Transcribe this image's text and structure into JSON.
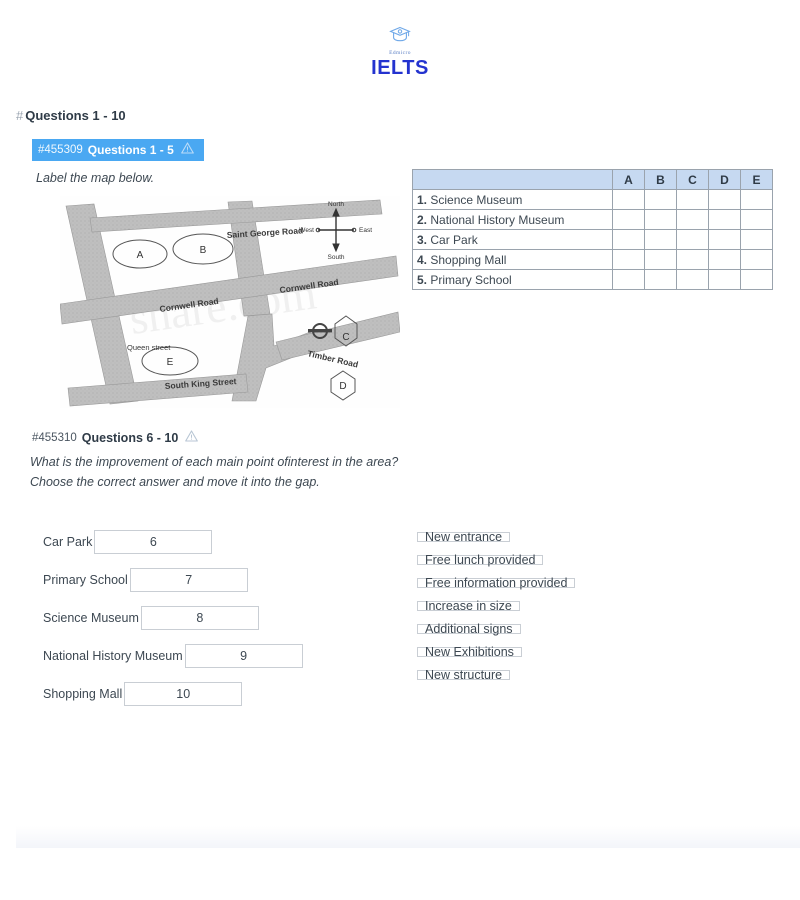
{
  "brand": {
    "icon": "graduation-cap-icon",
    "sub": "Edmicro",
    "name": "IELTS",
    "colors": {
      "wordmark": "#2433cf",
      "sub": "#5b7fc4",
      "accent": "#4aa8f2"
    }
  },
  "page_heading": {
    "hash": "#",
    "text": "Questions 1 - 10"
  },
  "sections": [
    {
      "id": "#455309",
      "title": "Questions 1 - 5",
      "warning_icon": "warning-triangle-icon",
      "instruction": "Label the map below."
    },
    {
      "id": "#455310",
      "title": "Questions 6 - 10",
      "warning_icon": "warning-triangle-icon",
      "instruction_line1": "What is the improvement of each main point ofinterest in the area?",
      "instruction_line2": "Choose the correct answer and move it into the gap."
    }
  ],
  "map": {
    "alt": "black and white scanned street map",
    "roads": [
      "Saint George Road",
      "Cornwell Road",
      "Cornwell Road",
      "Queen street",
      "South King Street",
      "Timber Road"
    ],
    "oval_labels": [
      "A",
      "B",
      "E"
    ],
    "hexagon_labels": [
      "C",
      "D"
    ],
    "compass": {
      "north": "North",
      "south": "South",
      "west": "West",
      "east": "East"
    },
    "watermark": "share.com",
    "station_icon": "underground-roundel-icon"
  },
  "answer_table": {
    "blank_header": "",
    "columns": [
      "A",
      "B",
      "C",
      "D",
      "E"
    ],
    "rows": [
      {
        "num": "1.",
        "label": "Science Museum"
      },
      {
        "num": "2.",
        "label": "National History Museum"
      },
      {
        "num": "3.",
        "label": "Car Park"
      },
      {
        "num": "4.",
        "label": "Shopping Mall"
      },
      {
        "num": "5.",
        "label": "Primary School"
      }
    ]
  },
  "gap_fill": {
    "rows": [
      {
        "label": "Car Park",
        "value": "6"
      },
      {
        "label": "Primary School",
        "value": "7"
      },
      {
        "label": "Science Museum",
        "value": "8"
      },
      {
        "label": "National History Museum",
        "value": "9"
      },
      {
        "label": "Shopping Mall",
        "value": "10"
      }
    ]
  },
  "options": [
    "New entrance",
    "Free lunch provided",
    "Free information provided",
    "Increase in size",
    "Additional signs",
    "New Exhibitions",
    "New structure"
  ]
}
